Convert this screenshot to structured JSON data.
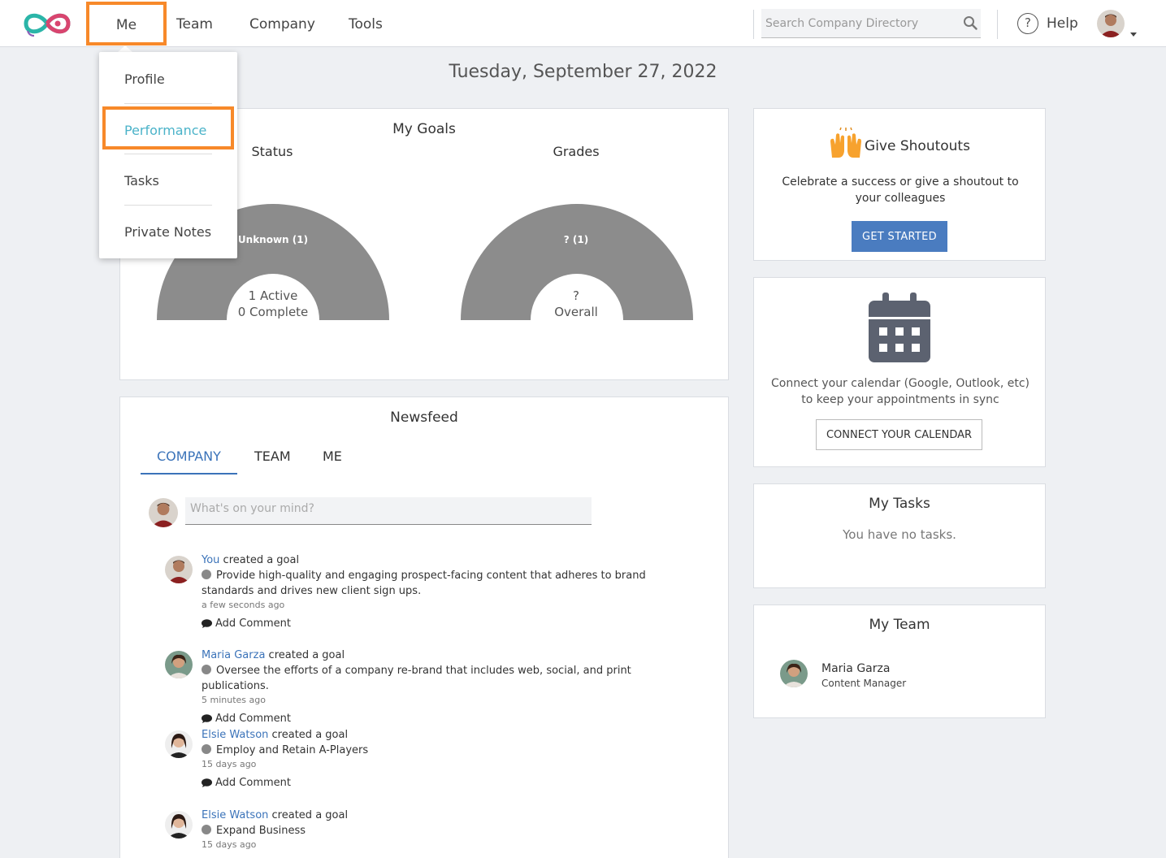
{
  "nav": {
    "items": [
      "Me",
      "Team",
      "Company",
      "Tools"
    ],
    "search_placeholder": "Search Company Directory",
    "help_label": "Help",
    "help_glyph": "?"
  },
  "date": "Tuesday, September 27, 2022",
  "me_menu": {
    "items": [
      "Profile",
      "Performance",
      "Tasks",
      "Private Notes"
    ],
    "highlighted": "Performance"
  },
  "goals": {
    "title": "My Goals",
    "status": {
      "title": "Status",
      "segment_label": "Unknown (1)",
      "center_line1": "1 Active",
      "center_line2": "0 Complete"
    },
    "grades": {
      "title": "Grades",
      "segment_label": "? (1)",
      "center_line1": "?",
      "center_line2": "Overall"
    }
  },
  "chart_data": [
    {
      "type": "pie",
      "title": "Status",
      "categories": [
        "Unknown"
      ],
      "values": [
        1
      ]
    },
    {
      "type": "pie",
      "title": "Grades",
      "categories": [
        "?"
      ],
      "values": [
        1
      ]
    }
  ],
  "newsfeed": {
    "title": "Newsfeed",
    "tabs": [
      "COMPANY",
      "TEAM",
      "ME"
    ],
    "active_tab": "COMPANY",
    "compose_placeholder": "What's on your mind?",
    "add_comment_label": "Add Comment",
    "items": [
      {
        "actor": "You",
        "action": " created a goal",
        "goal": "Provide high-quality and engaging prospect-facing content that adheres to brand standards and drives new client sign ups.",
        "ago": "a few seconds ago"
      },
      {
        "actor": "Maria Garza",
        "action": " created a goal",
        "goal": "Oversee the efforts of a company re-brand that includes web, social, and print publications.",
        "ago": "5 minutes ago"
      },
      {
        "actor": "Elsie Watson",
        "action": " created a goal",
        "goal": "Employ and Retain A-Players",
        "ago": "15 days ago"
      },
      {
        "actor": "Elsie Watson",
        "action": " created a goal",
        "goal": "Expand Business",
        "ago": "15 days ago"
      }
    ]
  },
  "shoutouts": {
    "title": "Give Shoutouts",
    "description": "Celebrate a success or give a shoutout to your colleagues",
    "button": "GET STARTED",
    "icon": "raised-hands-icon"
  },
  "calendar": {
    "description": "Connect your calendar (Google, Outlook, etc) to keep your appointments in sync",
    "button": "CONNECT YOUR CALENDAR",
    "icon": "calendar-icon"
  },
  "tasks": {
    "title": "My Tasks",
    "empty": "You have no tasks."
  },
  "team": {
    "title": "My Team",
    "members": [
      {
        "name": "Maria Garza",
        "role": "Content Manager"
      }
    ]
  },
  "colors": {
    "accent": "#3b73b9",
    "highlight": "#f7892a",
    "gauge": "#8c8c8c",
    "button": "#4a7cc0"
  }
}
